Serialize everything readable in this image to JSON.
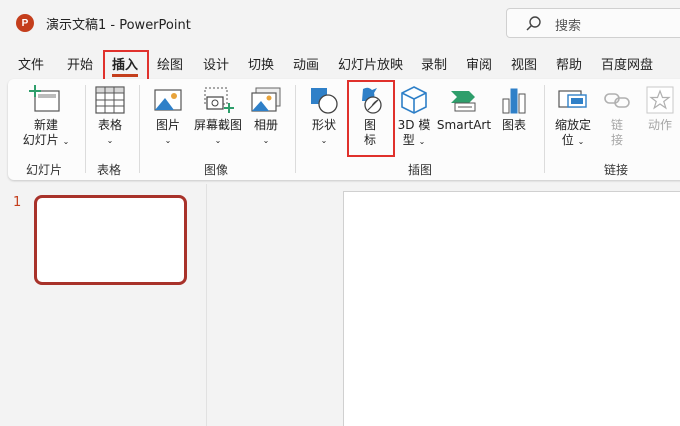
{
  "titlebar": {
    "app_icon_letter": "P",
    "title": "演示文稿1  -  PowerPoint",
    "search_placeholder": "搜索"
  },
  "tabs": [
    "文件",
    "开始",
    "插入",
    "绘图",
    "设计",
    "切换",
    "动画",
    "幻灯片放映",
    "录制",
    "审阅",
    "视图",
    "帮助",
    "百度网盘"
  ],
  "active_tab": "插入",
  "ribbon": {
    "new_slide_line1": "新建",
    "new_slide_line2": "幻灯片",
    "table": "表格",
    "pictures": "图片",
    "screenshot": "屏幕截图",
    "album": "相册",
    "shapes": "形状",
    "icons_line1": "图",
    "icons_line2": "标",
    "model3d_line1": "3D 模",
    "model3d_line2": "型",
    "smartart": "SmartArt",
    "chart": "图表",
    "zoom_line1": "缩放定",
    "zoom_line2": "位",
    "link_line1": "链",
    "link_line2": "接",
    "action": "动作",
    "groups": {
      "slides": "幻灯片",
      "tables": "表格",
      "images": "图像",
      "illustrations": "插图",
      "links": "链接"
    }
  },
  "slides": {
    "current_number": "1"
  },
  "colors": {
    "accent": "#c43e1c",
    "highlight": "#e0312c",
    "thumb_border": "#a8322a",
    "icon_blue": "#2f80c8",
    "icon_green": "#2e9e6b"
  }
}
